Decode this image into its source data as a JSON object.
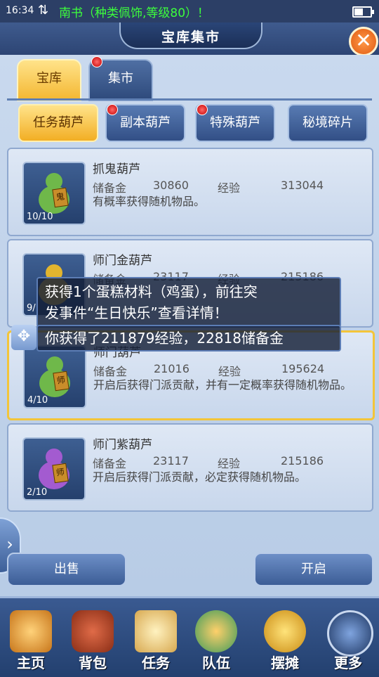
{
  "status_bar": {
    "time": "16:34",
    "marquee": "南书（种类佩饰,等级80）！"
  },
  "window": {
    "title": "宝库集市"
  },
  "tabs": [
    {
      "label": "宝库"
    },
    {
      "label": "集市"
    }
  ],
  "subtabs": [
    {
      "label": "任务葫芦"
    },
    {
      "label": "副本葫芦"
    },
    {
      "label": "特殊葫芦"
    },
    {
      "label": "秘境碎片"
    }
  ],
  "stat_labels": {
    "reserve": "储备金",
    "exp": "经验"
  },
  "items": [
    {
      "name": "抓鬼葫芦",
      "reserve": "30860",
      "exp": "313044",
      "desc": "有概率获得随机物品。",
      "count": "10/10",
      "tag": "鬼",
      "color": "#6fb84a"
    },
    {
      "name": "师门金葫芦",
      "reserve": "23117",
      "exp": "215186",
      "desc": "",
      "count": "9/",
      "tag": "",
      "color": "#e2b52e"
    },
    {
      "name": "师门葫芦",
      "reserve": "21016",
      "exp": "195624",
      "desc": "开启后获得门派贡献，并有一定概率获得随机物品。",
      "count": "4/10",
      "tag": "师",
      "color": "#6fb84a"
    },
    {
      "name": "师门紫葫芦",
      "reserve": "23117",
      "exp": "215186",
      "desc": "开启后获得门派贡献，必定获得随机物品。",
      "count": "2/10",
      "tag": "师",
      "color": "#a35bd0"
    }
  ],
  "notifications": [
    {
      "text1": "获得1个蛋糕材料（鸡蛋），前往突",
      "text2": "发事件“生日快乐”查看详情！"
    },
    {
      "text1": "你获得了211879经验，22818储备金"
    }
  ],
  "buttons": {
    "sell": "出售",
    "open": "开启"
  },
  "nav": [
    {
      "label": "主页"
    },
    {
      "label": "背包"
    },
    {
      "label": "任务"
    },
    {
      "label": "队伍"
    },
    {
      "label": "摆摊"
    },
    {
      "label": "更多"
    }
  ]
}
